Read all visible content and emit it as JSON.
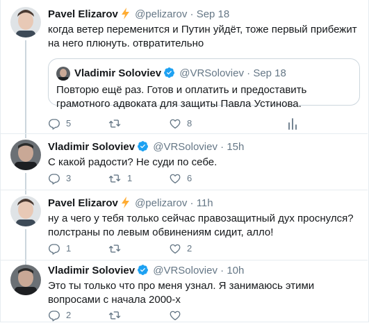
{
  "tweets": [
    {
      "name": "Pavel Elizarov",
      "badge": "lightning-icon",
      "handle": "@pelizarov",
      "dot": "·",
      "time": "Sep 18",
      "text": "когда ветер переменится и Путин уйдёт, тоже первый прибежит на него плюнуть. отвратительно",
      "quote": {
        "name": "Vladimir Soloviev",
        "badge": "verified-icon",
        "handle": "@VRSoloviev",
        "dot": "·",
        "time": "Sep 18",
        "text": "Повторю ещё раз. Готов и оплатить и предоставить грамотного адвоката для защиты Павла Устинова."
      },
      "replies": "5",
      "retweets": "",
      "likes": "8"
    },
    {
      "name": "Vladimir Soloviev",
      "badge": "verified-icon",
      "handle": "@VRSoloviev",
      "dot": "·",
      "time": "15h",
      "text": "С какой радости? Не суди по себе.",
      "replies": "3",
      "retweets": "1",
      "likes": "6"
    },
    {
      "name": "Pavel Elizarov",
      "badge": "lightning-icon",
      "handle": "@pelizarov",
      "dot": "·",
      "time": "11h",
      "text": "ну а чего у тебя только сейчас правозащитный дух проснулся? полстраны по левым обвинениям сидит, алло!",
      "replies": "1",
      "retweets": "",
      "likes": "2"
    },
    {
      "name": "Vladimir Soloviev",
      "badge": "verified-icon",
      "handle": "@VRSoloviev",
      "dot": "·",
      "time": "10h",
      "text": "Это ты только что про меня узнал. Я занимаюсь этими вопросами с начала 2000-х",
      "replies": "2",
      "retweets": "",
      "likes": ""
    }
  ],
  "colors": {
    "text": "#14171a",
    "secondary": "#657786",
    "verified": "#1da1f2",
    "lightning": "#ffac33",
    "border": "#e6ecf0",
    "thread": "#ccd6dd"
  }
}
